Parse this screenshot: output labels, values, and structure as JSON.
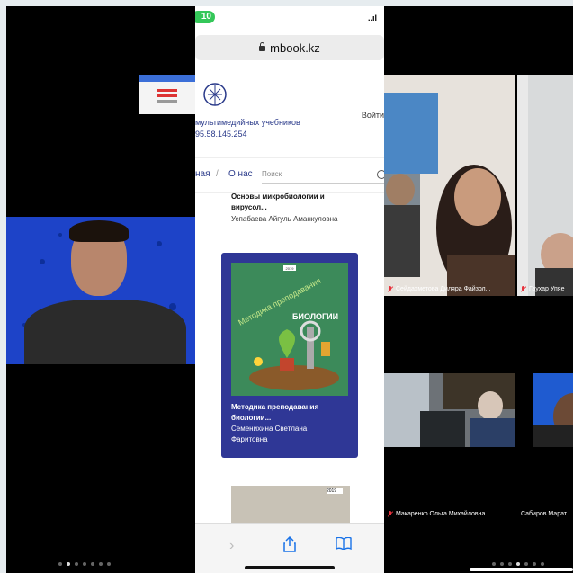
{
  "phone": {
    "battery": "10",
    "signal": "..ıl",
    "url": "mbook.kz",
    "site_title": "мультимедийных учебников",
    "site_phone": "95.58.145.254",
    "login": "Войти",
    "nav_main": "ная",
    "nav_sep": "/",
    "nav_about": "О нас",
    "search_placeholder": "Поиск",
    "book1": {
      "title_line1": "Основы микробиологии и",
      "title_line2": "вирусол...",
      "author": "Успабаева Айгуль Аманкуловна"
    },
    "card": {
      "cover_year": "2019",
      "cover_text1": "Методика преподавания",
      "cover_text2": "БИОЛОГИИ",
      "title_line1": "Методика преподавания",
      "title_line2": "биологии...",
      "author_line1": "Семенихина Светлана",
      "author_line2": "Фаритовна"
    },
    "card2_year": "2019",
    "toolbar_icons": [
      "chevron-right-icon",
      "share-icon",
      "book-icon"
    ]
  },
  "zoom": {
    "participants": [
      {
        "name": "Сейдахметова Диляра Файзол...",
        "muted": true
      },
      {
        "name": "Гаухар Упяе",
        "muted": true
      },
      {
        "name": "Макаренко Ольга Михайловна...",
        "muted": true
      },
      {
        "name": "Сабиров Марат",
        "muted": false
      }
    ]
  },
  "colors": {
    "left_bg": "#1d43c8",
    "card_bg": "#2f3796",
    "battery": "#34c759",
    "muted_mic": "#e8323c",
    "link_blue": "#2a3a8a"
  }
}
